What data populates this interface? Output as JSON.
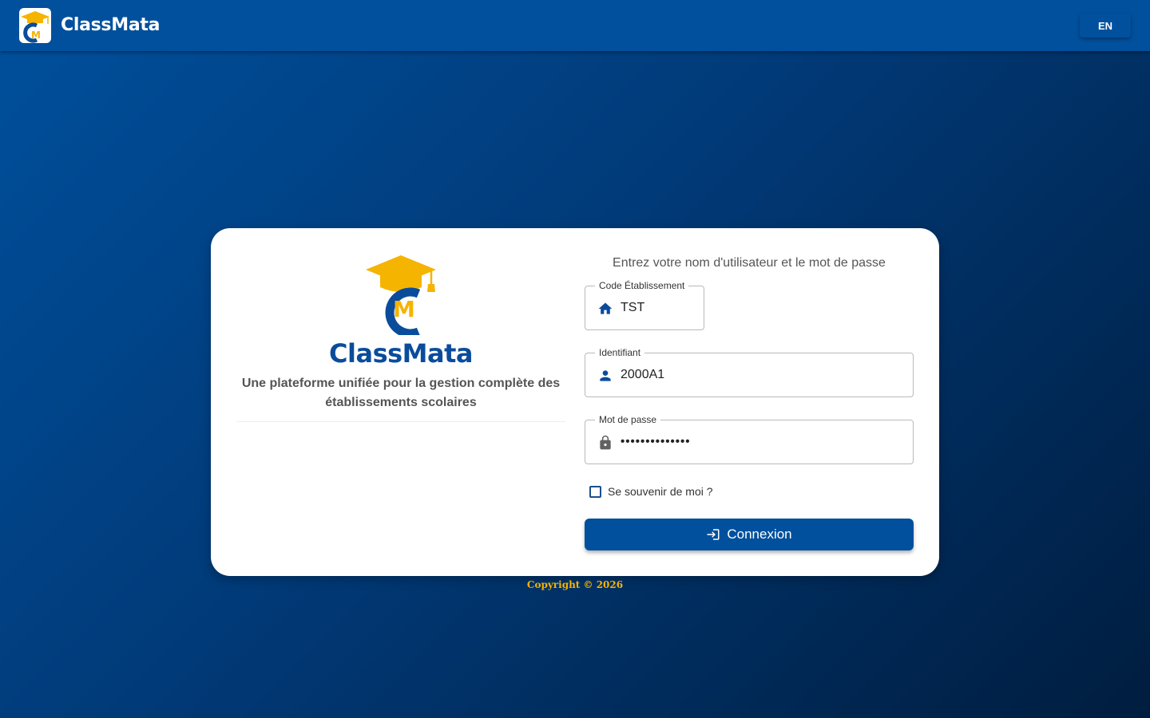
{
  "header": {
    "app_name": "ClassMata",
    "language_button": "EN"
  },
  "brand": {
    "title": "ClassMata",
    "tagline": "Une plateforme unifiée pour la gestion complète des établissements scolaires",
    "logo_letters": "CM"
  },
  "login": {
    "heading": "Entrez votre nom d'utilisateur et le mot de passe",
    "school_code": {
      "label": "Code Établissement",
      "value": "TST",
      "icon": "home-icon"
    },
    "username": {
      "label": "Identifiant",
      "value": "2000A1",
      "icon": "person-icon"
    },
    "password": {
      "label": "Mot de passe",
      "value": "••••••••••••••",
      "icon": "lock-icon"
    },
    "remember_me": {
      "label": "Se souvenir de moi ?",
      "checked": false
    },
    "submit_label": "Connexion"
  },
  "footer": {
    "copyright": "Copyright © 2026"
  },
  "colors": {
    "primary": "#00509d",
    "accent": "#f5b400",
    "brand_text": "#0a4c9c"
  }
}
